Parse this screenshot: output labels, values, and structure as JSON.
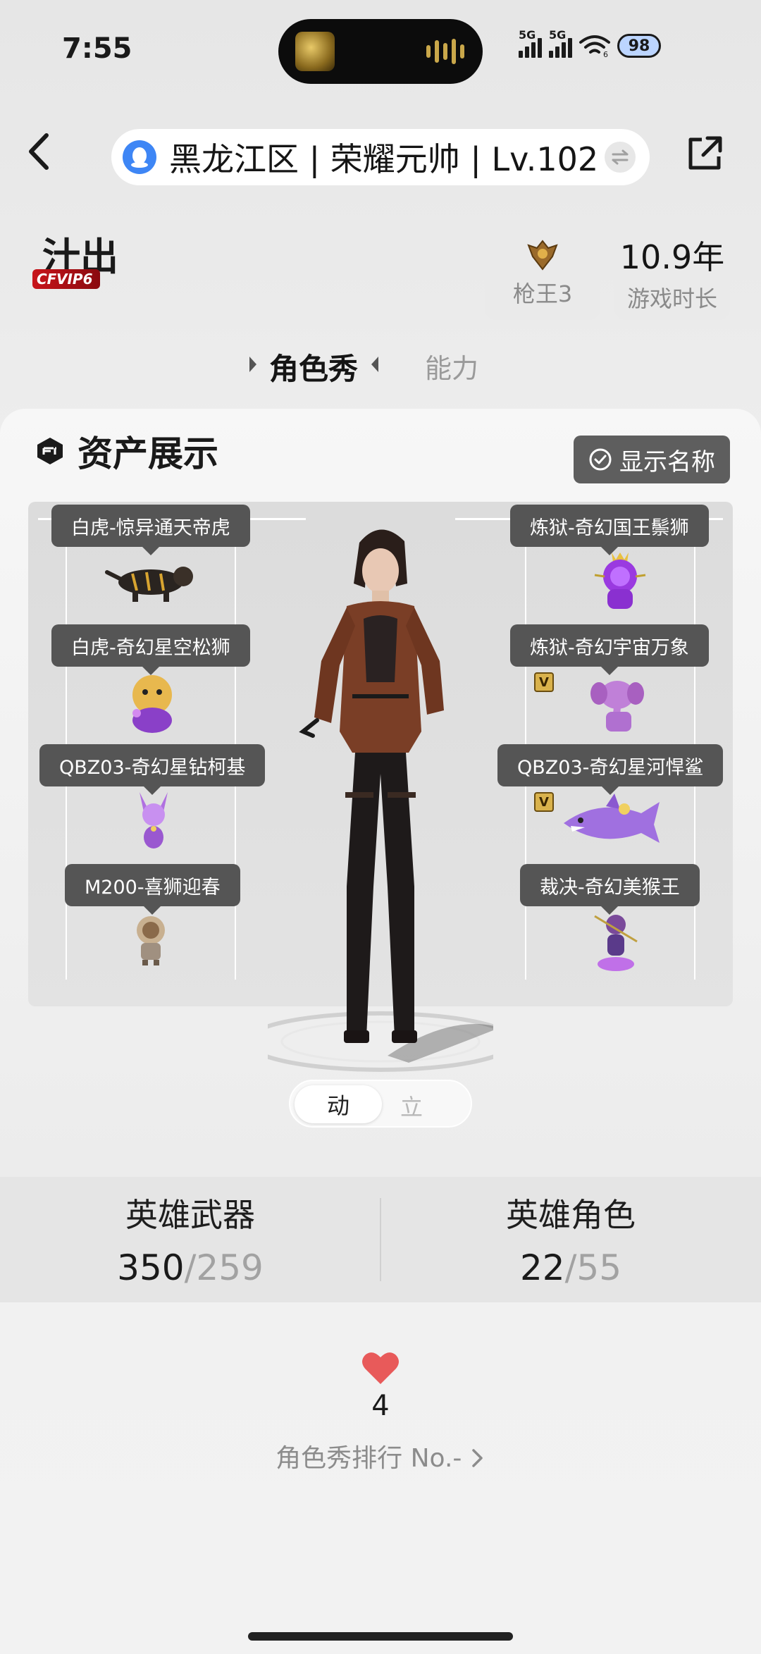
{
  "status_bar": {
    "time": "7:55",
    "signal1": "5G",
    "signal2": "5G",
    "wifi_sub": "6",
    "battery": "98"
  },
  "header": {
    "server": "黑龙江区 | 荣耀元帅 | Lv.102",
    "icons": [
      "back-icon",
      "qq-icon",
      "swap-icon",
      "share-icon"
    ]
  },
  "profile": {
    "nickname": "汁出",
    "vip": "VIP6",
    "vip_prefix": "CF",
    "rank_label": "枪王3",
    "play_years": "10.9年",
    "play_label": "游戏时长"
  },
  "tabs": {
    "active": "角色秀",
    "inactive": "能力"
  },
  "assets": {
    "title": "资产展示",
    "toggle_label": "显示名称",
    "left": [
      {
        "label": "白虎-惊异通天帝虎"
      },
      {
        "label": "白虎-奇幻星空松狮"
      },
      {
        "label": "QBZ03-奇幻星钻柯基"
      },
      {
        "label": "M200-喜狮迎春"
      }
    ],
    "right": [
      {
        "label": "炼狱-奇幻国王鬃狮"
      },
      {
        "label": "炼狱-奇幻宇宙万象",
        "badge": "V"
      },
      {
        "label": "QBZ03-奇幻星河悍鲨",
        "badge": "V"
      },
      {
        "label": "裁决-奇幻美猴王"
      }
    ],
    "mode_on": "动",
    "mode_off": "立"
  },
  "hero": {
    "weapons_label": "英雄武器",
    "weapons_current": "350",
    "weapons_total": "/259",
    "roles_label": "英雄角色",
    "roles_current": "22",
    "roles_total": "/55"
  },
  "likes": {
    "count": "4",
    "rank_text": "角色秀排行 No.- "
  },
  "colors": {
    "heart": "#e85a5a",
    "qq_blue": "#3e86f5",
    "vip_red": "#c8141a",
    "label_bg": "#555555"
  }
}
